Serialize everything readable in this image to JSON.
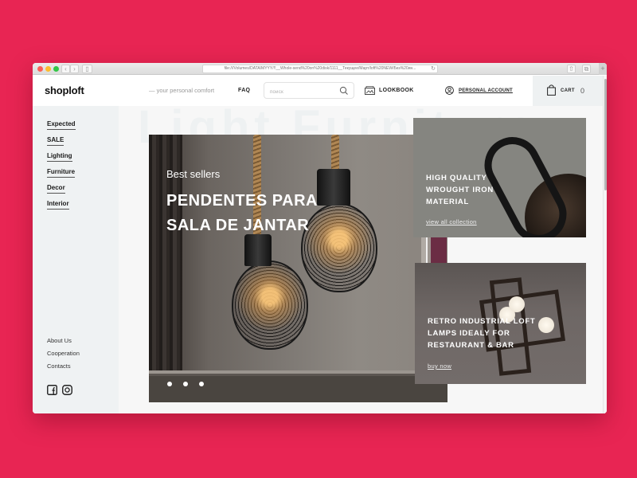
{
  "browser": {
    "url": "file:///Volumes/DATA/MYYY/!!__Whole-send%20on%20disk/1111__Текущее/Март/loft%20NEW/Без%20ин...",
    "reload_icon": "reload-icon",
    "buttons": [
      "back",
      "forward",
      "sidebar",
      "share",
      "tabs",
      "new-tab"
    ]
  },
  "header": {
    "logo": "shoploft",
    "tagline": "— your personal comfort",
    "faq": "FAQ",
    "search_placeholder": "поиск",
    "lookbook": "LOOKBOOK",
    "account": "PERSONAL ACCOUNT",
    "cart_label": "CART",
    "cart_count": "0"
  },
  "background_word": "Light Furniture",
  "sidebar": {
    "categories": [
      "Expected",
      "SALE",
      "Lighting",
      "Furniture",
      "Decor",
      "Interior"
    ],
    "footer_links": [
      "About Us",
      "Cooperation",
      "Contacts"
    ],
    "social": [
      "facebook-icon",
      "instagram-icon"
    ]
  },
  "hero": {
    "subtitle": "Best sellers",
    "title": "PENDENTES PARA SALA DE JANTAR",
    "slides": 3,
    "active_slide": 1
  },
  "cards": [
    {
      "title": "HIGH QUALITY WROUGHT IRON MATERIAL",
      "link": "view all collection"
    },
    {
      "title": "RETRO INDUSTRIAL LOFT LAMPS IDEALY FOR RESTAURANT & BAR",
      "link": "buy now"
    }
  ],
  "colors": {
    "background": "#e82553",
    "sidebar": "#eff2f3",
    "text": "#1a1a1a"
  }
}
